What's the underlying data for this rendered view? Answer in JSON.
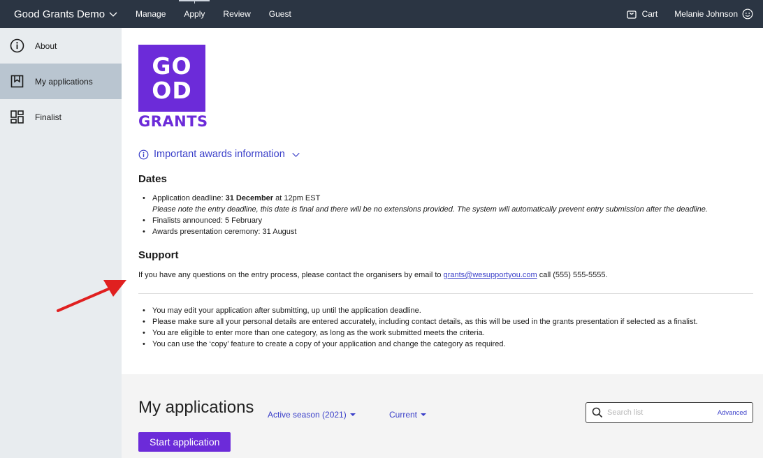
{
  "topbar": {
    "brand": "Good Grants Demo",
    "nav": [
      {
        "label": "Manage"
      },
      {
        "label": "Apply"
      },
      {
        "label": "Review"
      },
      {
        "label": "Guest"
      }
    ],
    "cart": "Cart",
    "user": "Melanie Johnson"
  },
  "sidebar": {
    "items": [
      {
        "label": "About",
        "icon": "info-circle-icon"
      },
      {
        "label": "My applications",
        "icon": "bookmark-icon"
      },
      {
        "label": "Finalist",
        "icon": "dashboard-icon"
      }
    ]
  },
  "logo": {
    "line1": "GO",
    "line2": "OD",
    "word": "GRANTS",
    "color": "#6c2bd9"
  },
  "info": {
    "toggle_label": "Important awards information",
    "dates_heading": "Dates",
    "deadline_prefix": "Application deadline: ",
    "deadline_bold": "31 December",
    "deadline_suffix": " at 12pm EST",
    "deadline_note": "Please note the entry deadline, this date is final and there will be no extensions provided. The system will automatically prevent entry submission after the deadline.",
    "finalists": "Finalists announced: 5 February",
    "ceremony": "Awards presentation ceremony: 31 August",
    "support_heading": "Support",
    "support_prefix": "If you have any questions on the entry process, please contact the organisers by email to ",
    "support_email": "grants@wesupportyou.com",
    "support_suffix": " call (555) 555-5555.",
    "tips": [
      "You may edit your application after submitting, up until the application deadline.",
      "Please make sure all your personal details are entered accurately, including contact details, as this will be used in the grants presentation if selected as a finalist.",
      "You are eligible to enter more than one category, as long as the work submitted meets the criteria.",
      "You can use the ‘copy’ feature to create a copy of your application and change the category as required."
    ]
  },
  "applications": {
    "title": "My applications",
    "season_filter": "Active season (2021)",
    "status_filter": "Current",
    "search_placeholder": "Search list",
    "advanced": "Advanced",
    "start_button": "Start application"
  },
  "colors": {
    "topbar": "#2b3543",
    "accent": "#6c2bd9",
    "link": "#3a3fc9",
    "annotation_arrow": "#e02020"
  }
}
